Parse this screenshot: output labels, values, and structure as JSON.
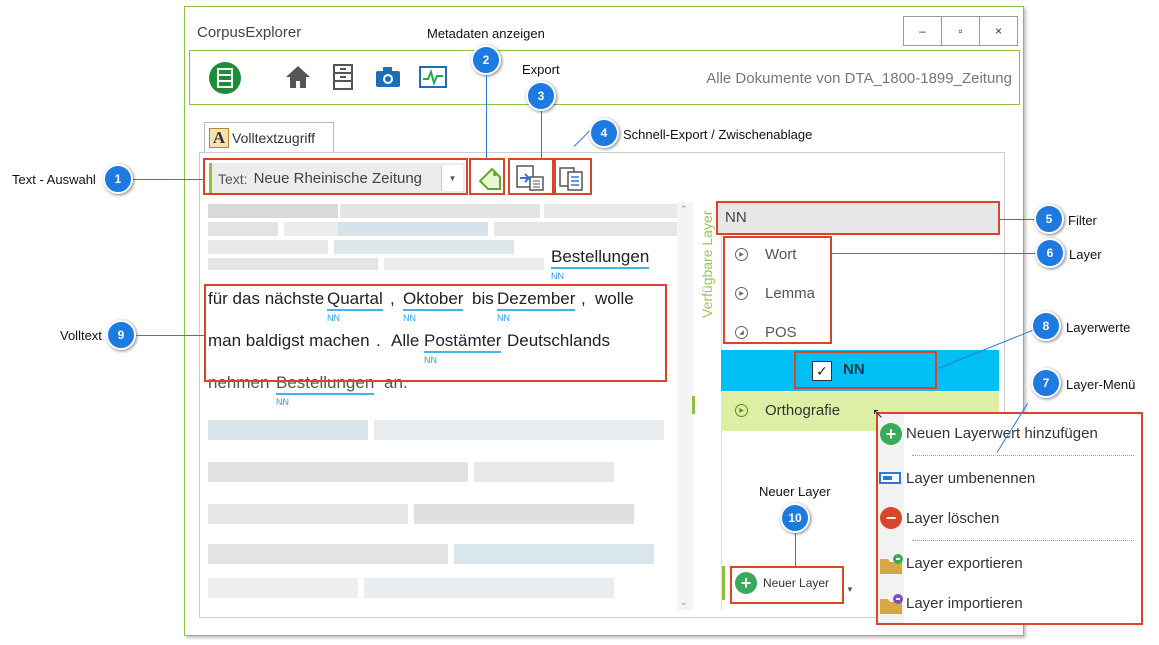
{
  "window": {
    "title": "CorpusExplorer",
    "minimize": "–",
    "maximize": "▫",
    "close": "×"
  },
  "ribbon": {
    "path_text": "Alle Dokumente von DTA_1800-1899_Zeitung",
    "icons": [
      "app-logo-icon",
      "home-icon",
      "archive-icon",
      "camera-icon",
      "monitor-chart-icon"
    ]
  },
  "tab": {
    "label": "Volltextzugriff",
    "icon_letter": "A"
  },
  "text_select": {
    "label": "Text:",
    "value": "Neue Rheinische Zeitung"
  },
  "toolbar": {
    "icons": [
      "tag-icon",
      "export-icon",
      "copy-icon"
    ]
  },
  "fulltext": {
    "line1": {
      "w1": "Bestellungen",
      "t1": "NN"
    },
    "line2": {
      "w1": "für das nächste",
      "w2": "Quartal",
      "w3": ",",
      "w4": "Oktober",
      "w5": "bis",
      "w6": "Dezember",
      "w7": ",",
      "w8": "wolle",
      "t2": "NN",
      "t4": "NN",
      "t6": "NN"
    },
    "line3": {
      "w1": "man baldigst machen",
      "w2": ".",
      "w3": "Alle",
      "w4": "Postämter",
      "w5": "Deutschlands",
      "t4": "NN"
    },
    "line4": {
      "w1": "nehmen",
      "w2": "Bestellungen",
      "w3": "an",
      "w4": ".",
      "t2": "NN"
    }
  },
  "layers": {
    "side_label": "Verfügbare Layer",
    "filter_value": "NN",
    "items": [
      "Wort",
      "Lemma",
      "POS"
    ],
    "selected_value": "NN",
    "check": "✓",
    "ortho": "Orthografie",
    "new_layer_button": "Neuer Layer"
  },
  "menu": {
    "items": [
      "Neuen Layerwert hinzufügen",
      "Layer umbenennen",
      "Layer löschen",
      "Layer exportieren",
      "Layer importieren"
    ]
  },
  "callouts": {
    "c1": {
      "num": "1",
      "label": "Text - Auswahl"
    },
    "c2": {
      "num": "2",
      "label": "Metadaten anzeigen"
    },
    "c3": {
      "num": "3",
      "label": "Export"
    },
    "c4": {
      "num": "4",
      "label": "Schnell-Export / Zwischenablage"
    },
    "c5": {
      "num": "5",
      "label": "Filter"
    },
    "c6": {
      "num": "6",
      "label": "Layer"
    },
    "c7": {
      "num": "7",
      "label": "Layer-Menü"
    },
    "c8": {
      "num": "8",
      "label": "Layerwerte"
    },
    "c9": {
      "num": "9",
      "label": "Volltext"
    },
    "c10": {
      "num": "10",
      "label": "Neuer Layer"
    }
  },
  "colors": {
    "accent_green": "#8dc03c",
    "highlight_blue": "#00bff3",
    "ortho_green": "#ddefa5",
    "callout_blue": "#1d7be0",
    "annotation_red": "#d9452b",
    "tag_blue": "#2a9de0"
  }
}
